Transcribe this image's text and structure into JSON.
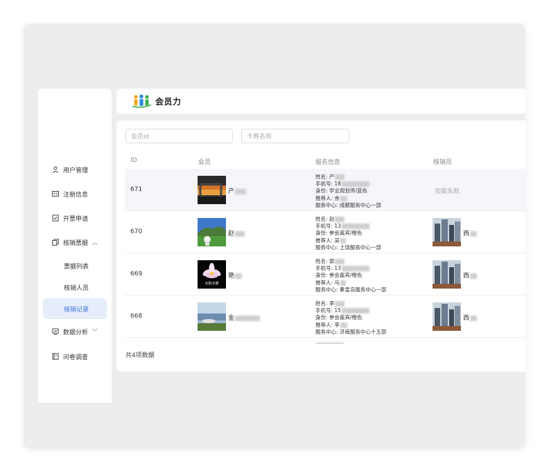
{
  "sidebar": {
    "items": [
      {
        "label": "用户管理",
        "icon": "user-icon"
      },
      {
        "label": "注册信息",
        "icon": "id-card-icon"
      },
      {
        "label": "开票申请",
        "icon": "invoice-icon"
      },
      {
        "label": "核销票据",
        "icon": "ticket-icon",
        "expanded": true
      },
      {
        "label": "数据分析",
        "icon": "chart-icon",
        "expanded": false
      },
      {
        "label": "问卷调查",
        "icon": "survey-icon"
      }
    ],
    "sub_items": [
      "票据列表",
      "核销人员",
      "核销记录"
    ],
    "active_sub": "核销记录"
  },
  "header": {
    "logo_text": "会员力"
  },
  "search": {
    "member_id_placeholder": "会员id",
    "coupon_name_placeholder": "卡券名称"
  },
  "table": {
    "columns": [
      "ID",
      "会员",
      "报名信息",
      "核销员"
    ],
    "rows": [
      {
        "id": "671",
        "member_name": "产",
        "info": [
          "姓名: 产",
          "手机号: 18",
          "身份: 学业观划师/蓝色",
          "推荐人: 余",
          "服务中心: 成都服务中心一部"
        ],
        "verifier": "",
        "verifier_status": "加载失败"
      },
      {
        "id": "670",
        "member_name": "赵",
        "info": [
          "姓名: 赵",
          "手机号: 13",
          "身份: 参会嘉宾/橙色",
          "推荐人: 吴",
          "服务中心: 上饶服务中心一部"
        ],
        "verifier": "西"
      },
      {
        "id": "669",
        "member_name": "艳",
        "avatar_caption": "大别大佬",
        "info": [
          "姓名: 郭",
          "手机号: 13",
          "身份: 参会嘉宾/橙色",
          "推荐人: 马",
          "服务中心: 秦皇岛服务中心一部"
        ],
        "verifier": "西"
      },
      {
        "id": "668",
        "member_name": "金",
        "info": [
          "姓名: 李",
          "手机号: 15",
          "身份: 参会嘉宾/橙色",
          "推荐人: 李",
          "服务中心: 济南服务中心十五部"
        ],
        "verifier": "西"
      }
    ]
  },
  "footer": {
    "total": "共4项数据"
  },
  "colors": {
    "accent": "#3a6fd8",
    "active_bg": "#e6eefb",
    "background": "#ededed"
  }
}
